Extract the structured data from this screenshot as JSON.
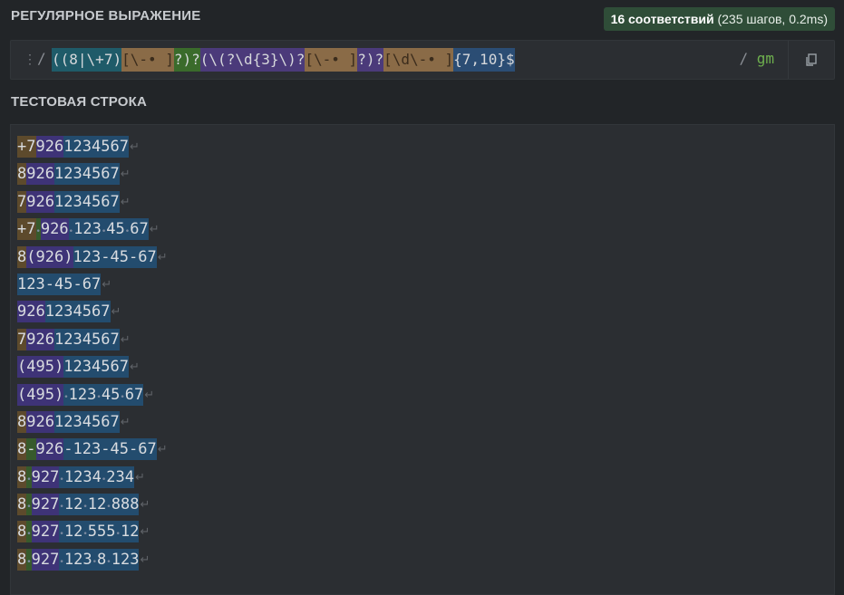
{
  "header": {
    "regex_label": "РЕГУЛЯРНОЕ ВЫРАЖЕНИЕ",
    "match_count": "16 соответствий",
    "match_meta": "(235 шагов, 0.2ms)"
  },
  "regex": {
    "open_slash": "/",
    "parts": [
      "((8",
      "|",
      "\\+7)",
      "[\\-• ]",
      "?)?",
      "(\\(",
      "?\\d{3}",
      "\\)",
      "?",
      "[\\-• ]",
      "?)?",
      "[\\d\\-• ]",
      "{7,10}$"
    ],
    "close_slash": "/",
    "flags": "gm"
  },
  "test": {
    "label": "ТЕСТОВАЯ СТРОКА",
    "return_glyph": "↵",
    "lines": [
      [
        [
          "+7",
          "a"
        ],
        [
          "926",
          "b"
        ],
        [
          "1234567",
          "c"
        ]
      ],
      [
        [
          "8",
          "a"
        ],
        [
          "926",
          "b"
        ],
        [
          "1234567",
          "c"
        ]
      ],
      [
        [
          "7",
          "a"
        ],
        [
          "926",
          "b"
        ],
        [
          "1234567",
          "c"
        ]
      ],
      [
        [
          "+7",
          "a"
        ],
        [
          "•",
          "g"
        ],
        [
          "926",
          "b"
        ],
        [
          "•123•45•67",
          "c"
        ]
      ],
      [
        [
          "8",
          "a"
        ],
        [
          "(926)",
          "b"
        ],
        [
          "123-45-67",
          "c"
        ]
      ],
      [
        [
          "123-45-67",
          "c"
        ]
      ],
      [
        [
          "926",
          "b"
        ],
        [
          "1234567",
          "c"
        ]
      ],
      [
        [
          "7",
          "a"
        ],
        [
          "926",
          "b"
        ],
        [
          "1234567",
          "c"
        ]
      ],
      [
        [
          "(495)",
          "b"
        ],
        [
          "1234567",
          "c"
        ]
      ],
      [
        [
          "(495)",
          "b"
        ],
        [
          "•123•45•67",
          "c"
        ]
      ],
      [
        [
          "8",
          "a"
        ],
        [
          "926",
          "b"
        ],
        [
          "1234567",
          "c"
        ]
      ],
      [
        [
          "8",
          "a"
        ],
        [
          "-",
          "g"
        ],
        [
          "926",
          "b"
        ],
        [
          "-123-45-67",
          "c"
        ]
      ],
      [
        [
          "8",
          "a"
        ],
        [
          "•",
          "g"
        ],
        [
          "927",
          "b"
        ],
        [
          "•1234•234",
          "c"
        ]
      ],
      [
        [
          "8",
          "a"
        ],
        [
          "•",
          "g"
        ],
        [
          "927",
          "b"
        ],
        [
          "•12•12•888",
          "c"
        ]
      ],
      [
        [
          "8",
          "a"
        ],
        [
          "•",
          "g"
        ],
        [
          "927",
          "b"
        ],
        [
          "•12•555•12",
          "c"
        ]
      ],
      [
        [
          "8",
          "a"
        ],
        [
          "•",
          "g"
        ],
        [
          "927",
          "b"
        ],
        [
          "•123•8•123",
          "c"
        ]
      ]
    ]
  },
  "icons": {
    "drag": "drag-handle-icon",
    "copy": "copy-icon"
  }
}
